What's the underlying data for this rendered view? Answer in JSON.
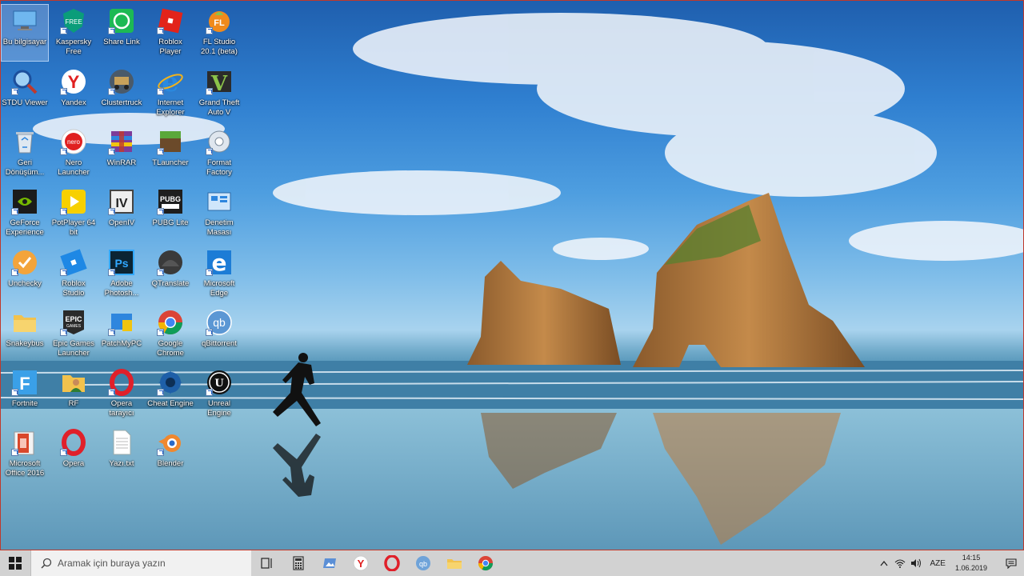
{
  "desktop": {
    "icons": [
      {
        "label": "Bu bilgisayar",
        "icon": "this-pc-icon",
        "selected": true
      },
      {
        "label": "Kaspersky Free",
        "icon": "kaspersky-icon"
      },
      {
        "label": "Share Link",
        "icon": "share-link-icon"
      },
      {
        "label": "Roblox Player",
        "icon": "roblox-icon"
      },
      {
        "label": "FL Studio 20.1 (beta)",
        "icon": "fl-studio-icon"
      },
      {
        "label": "STDU Viewer",
        "icon": "stdu-viewer-icon"
      },
      {
        "label": "Yandex",
        "icon": "yandex-icon"
      },
      {
        "label": "Clustertruck",
        "icon": "clustertruck-icon"
      },
      {
        "label": "Internet Explorer",
        "icon": "internet-explorer-icon"
      },
      {
        "label": "Grand Theft Auto V",
        "icon": "gta-v-icon"
      },
      {
        "label": "Geri Dönüşüm...",
        "icon": "recycle-bin-icon"
      },
      {
        "label": "Nero Launcher",
        "icon": "nero-icon"
      },
      {
        "label": "WinRAR",
        "icon": "winrar-icon"
      },
      {
        "label": "TLauncher",
        "icon": "tlauncher-icon"
      },
      {
        "label": "Format Factory",
        "icon": "format-factory-icon"
      },
      {
        "label": "GeForce Experience",
        "icon": "geforce-icon"
      },
      {
        "label": "PotPlayer 64 bit",
        "icon": "potplayer-icon"
      },
      {
        "label": "OpenIV",
        "icon": "openiv-icon"
      },
      {
        "label": "PUBG Lite",
        "icon": "pubg-lite-icon"
      },
      {
        "label": "Denetim Masası",
        "icon": "control-panel-icon"
      },
      {
        "label": "Unchecky",
        "icon": "unchecky-icon"
      },
      {
        "label": "Roblox Studio",
        "icon": "roblox-studio-icon"
      },
      {
        "label": "Adobe Photosh...",
        "icon": "photoshop-icon"
      },
      {
        "label": "QTranslate",
        "icon": "qtranslate-icon"
      },
      {
        "label": "Microsoft Edge",
        "icon": "edge-icon"
      },
      {
        "label": "Snakeybus",
        "icon": "folder-icon"
      },
      {
        "label": "Epic Games Launcher",
        "icon": "epic-games-icon"
      },
      {
        "label": "PatchMyPC",
        "icon": "patchmypc-icon"
      },
      {
        "label": "Google Chrome",
        "icon": "chrome-icon"
      },
      {
        "label": "qBittorrent",
        "icon": "qbittorrent-icon"
      },
      {
        "label": "Fortnite",
        "icon": "fortnite-icon"
      },
      {
        "label": "RF",
        "icon": "user-folder-icon"
      },
      {
        "label": "Opera tarayıcı",
        "icon": "opera-icon"
      },
      {
        "label": "Cheat Engine",
        "icon": "cheat-engine-icon"
      },
      {
        "label": "Unreal Engine",
        "icon": "unreal-engine-icon"
      },
      {
        "label": "Microsoft Office 2016",
        "icon": "office-icon"
      },
      {
        "label": "Opera",
        "icon": "opera-icon"
      },
      {
        "label": "Yazı.txt",
        "icon": "text-file-icon"
      },
      {
        "label": "Blender",
        "icon": "blender-icon"
      }
    ]
  },
  "taskbar": {
    "search_placeholder": "Aramak için buraya yazın",
    "pinned": [
      "task-view-icon",
      "calculator-icon",
      "photos-icon",
      "yandex-icon",
      "opera-icon",
      "qbittorrent-icon",
      "file-explorer-icon",
      "chrome-icon"
    ],
    "language": "AZE",
    "time": "14:15",
    "date": "1.06.2019"
  },
  "colors": {
    "taskbar_bg": "#d2d2d2",
    "search_bg": "#f1f1f1",
    "selection": "#b4d2f5"
  }
}
